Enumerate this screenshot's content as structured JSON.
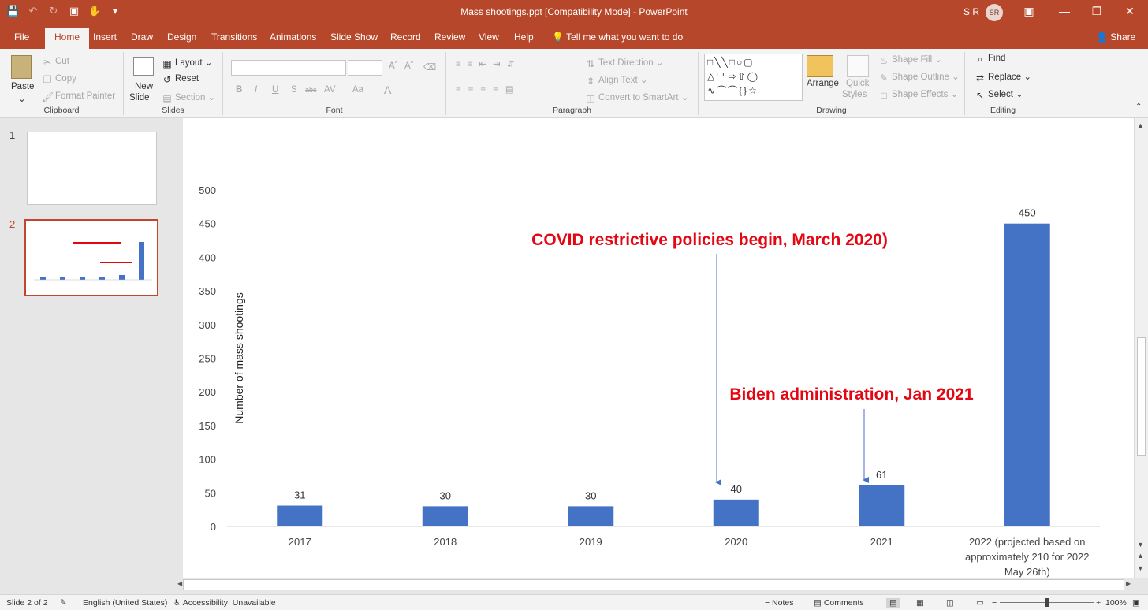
{
  "window": {
    "title": "Mass shootings.ppt  [Compatibility Mode]  -  PowerPoint",
    "user_initials": "S R",
    "avatar_text": "SR"
  },
  "tabs": [
    "File",
    "Home",
    "Insert",
    "Draw",
    "Design",
    "Transitions",
    "Animations",
    "Slide Show",
    "Record",
    "Review",
    "View",
    "Help"
  ],
  "tell_me": "Tell me what you want to do",
  "share": "Share",
  "ribbon": {
    "clipboard": {
      "paste": "Paste",
      "cut": "Cut",
      "copy": "Copy",
      "format_painter": "Format Painter",
      "label": "Clipboard"
    },
    "slides": {
      "new_slide_1": "New",
      "new_slide_2": "Slide",
      "layout": "Layout",
      "reset": "Reset",
      "section": "Section",
      "label": "Slides"
    },
    "font": {
      "bold": "B",
      "italic": "I",
      "underline": "U",
      "strike": "S",
      "abc": "abc",
      "av": "AV",
      "aa": "Aa",
      "label": "Font"
    },
    "paragraph": {
      "text_direction": "Text Direction",
      "align_text": "Align Text",
      "smartart": "Convert to SmartArt",
      "label": "Paragraph"
    },
    "drawing": {
      "arrange": "Arrange",
      "quick_styles_1": "Quick",
      "quick_styles_2": "Styles",
      "shape_fill": "Shape Fill",
      "shape_outline": "Shape Outline",
      "shape_effects": "Shape Effects",
      "label": "Drawing"
    },
    "editing": {
      "find": "Find",
      "replace": "Replace",
      "select": "Select",
      "label": "Editing"
    }
  },
  "thumbnails": {
    "slide1_number": "1",
    "slide2_number": "2"
  },
  "status": {
    "slide_counter": "Slide 2 of 2",
    "language": "English (United States)",
    "accessibility": "Accessibility: Unavailable",
    "notes": "Notes",
    "comments": "Comments",
    "zoom": "100%"
  },
  "chart_data": {
    "type": "bar",
    "categories": [
      "2017",
      "2018",
      "2019",
      "2020",
      "2021",
      "2022 (projected based on approximately 210 for 2022 May 26th)"
    ],
    "values": [
      31,
      30,
      30,
      40,
      61,
      450
    ],
    "ylabel": "Number of mass shootings",
    "ylim": [
      0,
      500
    ],
    "yticks": [
      0,
      50,
      100,
      150,
      200,
      250,
      300,
      350,
      400,
      450,
      500
    ],
    "bar_color": "#4472c4",
    "annotations": [
      {
        "text": "COVID restrictive policies begin, March 2020)",
        "color": "#e30613",
        "points_to": "2020"
      },
      {
        "text": "Biden administration, Jan 2021",
        "color": "#e30613",
        "points_to": "2021"
      }
    ]
  }
}
